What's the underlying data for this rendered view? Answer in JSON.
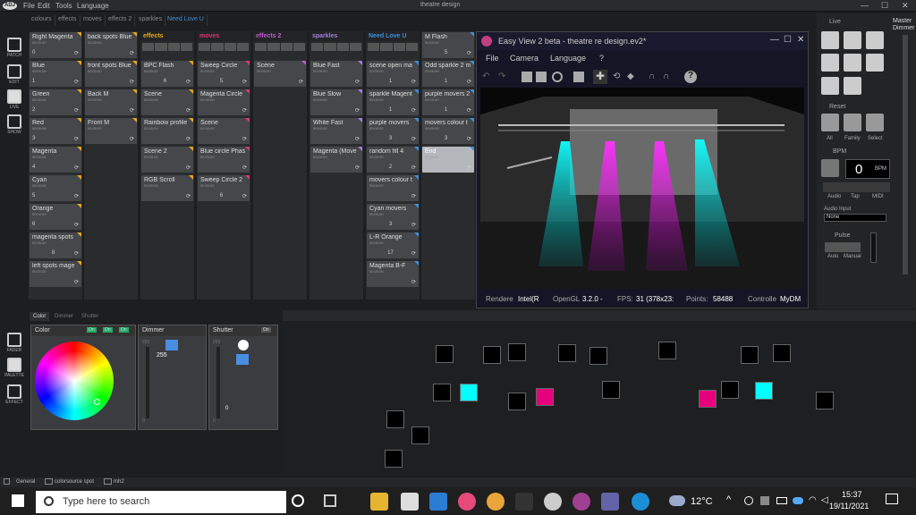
{
  "titlebar": {
    "logo": "ADJ",
    "menu": [
      "File",
      "Edit",
      "Tools",
      "Language"
    ],
    "title": "theatre design"
  },
  "scene_tabs": [
    "colours",
    "effects",
    "moves",
    "effects 2",
    "sparkles",
    "Need Love U"
  ],
  "left_toolbar": [
    {
      "label": "PATCH",
      "icon": "patch-icon"
    },
    {
      "label": "EDIT",
      "icon": "edit-icon"
    },
    {
      "label": "LIVE",
      "icon": "live-icon"
    },
    {
      "label": "SHOW",
      "icon": "show-icon"
    }
  ],
  "columns": [
    {
      "title": "colours",
      "color": "#e6a817",
      "cells": [
        {
          "name": "Right Magenta",
          "time": "00:00:00",
          "key": "0",
          "count": "",
          "corner": "#e6a817"
        },
        {
          "name": "Blue",
          "time": "00:00:05",
          "key": "1",
          "count": "",
          "corner": "#e6a817"
        },
        {
          "name": "Green",
          "time": "00:00:06",
          "key": "2",
          "count": "",
          "corner": "#e6a817"
        },
        {
          "name": "Red",
          "time": "00:00:06",
          "key": "3",
          "count": "",
          "corner": "#e6a817"
        },
        {
          "name": "Magenta",
          "time": "00:00:06",
          "key": "4",
          "count": "",
          "corner": "#e6a817"
        },
        {
          "name": "Cyan",
          "time": "00:00:06",
          "key": "5",
          "count": "",
          "corner": "#e6a817"
        },
        {
          "name": "Orange",
          "time": "00:00:00",
          "key": "6",
          "count": "",
          "corner": "#e6a817"
        },
        {
          "name": "magenta spots",
          "time": "00:00:00",
          "key": "",
          "count": "8",
          "corner": "#e6a817"
        },
        {
          "name": "left spots mage",
          "time": "00:00:00",
          "key": "",
          "count": "",
          "corner": "#e6a817"
        }
      ]
    },
    {
      "title": "",
      "color": "#e6a817",
      "cells": [
        {
          "name": "back spots Blue",
          "time": "00:00:00",
          "key": "",
          "count": "",
          "corner": "#e6a817"
        },
        {
          "name": "front spots Blue",
          "time": "00:00:00",
          "key": "",
          "count": "",
          "corner": "#e6a817"
        },
        {
          "name": "Back M",
          "time": "00:00:00",
          "key": "",
          "count": "",
          "corner": "#e6a817"
        },
        {
          "name": "Front M",
          "time": "00:00:00",
          "key": "",
          "count": "",
          "corner": "#e6a817"
        }
      ]
    },
    {
      "title": "effects",
      "color": "#e6a817",
      "cells": [
        {
          "name": "BPC Flash",
          "time": "00:00:00",
          "key": "",
          "count": "6",
          "corner": "#e6a817"
        },
        {
          "name": "Scene",
          "time": "00:00:00",
          "key": "",
          "count": "",
          "corner": "#e6a817"
        },
        {
          "name": "Rainbow profile",
          "time": "00:00:00",
          "key": "",
          "count": "",
          "corner": "#e6a817"
        },
        {
          "name": "Scene 2",
          "time": "00:00:00",
          "key": "",
          "count": "",
          "corner": "#e6a817"
        },
        {
          "name": "RGB Scroll",
          "time": "00:00:00",
          "key": "",
          "count": "",
          "corner": "#e6a817"
        }
      ]
    },
    {
      "title": "moves",
      "color": "#d93a6a",
      "cells": [
        {
          "name": "Sweep Circle",
          "time": "00:00:00",
          "key": "",
          "count": "5",
          "corner": "#d93a6a"
        },
        {
          "name": "Magenta Circle",
          "time": "00:00:00",
          "key": "",
          "count": "",
          "corner": "#d93a6a"
        },
        {
          "name": "Scene",
          "time": "00:00:00",
          "key": "",
          "count": "",
          "corner": "#d93a6a"
        },
        {
          "name": "Blue circle Phas",
          "time": "00:00:00",
          "key": "",
          "count": "",
          "corner": "#d93a6a"
        },
        {
          "name": "Sweep Circle 2",
          "time": "00:00:00",
          "key": "",
          "count": "6",
          "corner": "#d93a6a"
        }
      ]
    },
    {
      "title": "effects 2",
      "color": "#c05ad0",
      "cells": [
        {
          "name": "Scene",
          "time": "00:00:00",
          "key": "",
          "count": "",
          "corner": "#c05ad0"
        }
      ]
    },
    {
      "title": "sparkles",
      "color": "#a47ee0",
      "cells": [
        {
          "name": "Blue Fast",
          "time": "00:00:00",
          "key": "",
          "count": "",
          "corner": "#a47ee0"
        },
        {
          "name": "Blue Slow",
          "time": "00:00:00",
          "key": "",
          "count": "",
          "corner": "#a47ee0"
        },
        {
          "name": "White Fast",
          "time": "00:00:00",
          "key": "",
          "count": "",
          "corner": "#a47ee0"
        },
        {
          "name": "Magenta (Move",
          "time": "00:00:00",
          "key": "",
          "count": "",
          "corner": "#a47ee0"
        }
      ]
    },
    {
      "title": "Need Love U",
      "color": "#3b8fd8",
      "cells": [
        {
          "name": "scene open ma",
          "time": "00:00:00",
          "key": "",
          "count": "1",
          "corner": "#3b8fd8"
        },
        {
          "name": "sparkle Magent",
          "time": "00:00:00",
          "key": "",
          "count": "1",
          "corner": "#3b8fd8"
        },
        {
          "name": "purple movers",
          "time": "00:00:00",
          "key": "",
          "count": "3",
          "corner": "#3b8fd8"
        },
        {
          "name": "random fill 4",
          "time": "00:00:00",
          "key": "",
          "count": "2",
          "corner": "#3b8fd8"
        },
        {
          "name": "movers colour t",
          "time": "00:00:00",
          "key": "",
          "count": "",
          "corner": "#3b8fd8"
        },
        {
          "name": "Cyan movers",
          "time": "00:00:00",
          "key": "",
          "count": "3",
          "corner": "#3b8fd8"
        },
        {
          "name": "L-R Orange",
          "time": "00:00:00",
          "key": "",
          "count": "17",
          "corner": "#3b8fd8"
        },
        {
          "name": "Magenta B-F",
          "time": "00:00:00",
          "key": "",
          "count": "",
          "corner": "#3b8fd8"
        }
      ]
    },
    {
      "title": "",
      "color": "#3b8fd8",
      "cells": [
        {
          "name": "M Flash",
          "time": "00:00:00",
          "key": "",
          "count": "5",
          "corner": "#3b8fd8"
        },
        {
          "name": "Odd sparkle 2 m",
          "time": "00:00:00",
          "key": "",
          "count": "1",
          "corner": "#3b8fd8"
        },
        {
          "name": "purple movers 2",
          "time": "00:00:00",
          "key": "",
          "count": "1",
          "corner": "#3b8fd8"
        },
        {
          "name": "movers colour t",
          "time": "00:00:00",
          "key": "",
          "count": "3",
          "corner": "#3b8fd8"
        },
        {
          "name": "End",
          "time": "00:00:00",
          "key": "",
          "count": "",
          "corner": "#3b8fd8",
          "selected": true
        }
      ]
    }
  ],
  "easyview": {
    "title": "Easy View 2 beta - theatre re design.ev2*",
    "menu": [
      "File",
      "Camera",
      "Language",
      "?"
    ],
    "status": {
      "render_label": "Rendere",
      "render_value": "Intel(R",
      "opengl_label": "OpenGL",
      "opengl_value": "3.2.0 -",
      "fps_label": "FPS:",
      "fps_value": "31 (378x23:",
      "points_label": "Points:",
      "points_value": "58488",
      "control_label": "Controlle",
      "control_value": "MyDM"
    }
  },
  "right_panel": {
    "live_label": "Live",
    "master_label": "Master",
    "dimmer_label": "Dimmer",
    "reset_label": "Reset",
    "reset_buttons": [
      "All",
      "Family",
      "Select"
    ],
    "bpm_label": "BPM",
    "bpm_value": "0",
    "bpm_unit": "BPM",
    "bpm_buttons": [
      "Audio",
      "Tap",
      "MIDI"
    ],
    "audio_input_label": "Audio Input",
    "audio_input_value": "None",
    "pulse_label": "Pulse",
    "pulse_buttons": [
      "Auto",
      "Manual"
    ]
  },
  "bottom_tabs": [
    "Color",
    "Dimmer",
    "Shutter"
  ],
  "color_panel": {
    "title": "Color",
    "toggles": [
      "On",
      "On",
      "On"
    ]
  },
  "dimmer_panel": {
    "title": "Dimmer",
    "value": "255",
    "scale_top": "255",
    "scale_bottom": "0"
  },
  "shutter_panel": {
    "title": "Shutter",
    "toggle": "On",
    "value": "0",
    "scale_top": "255",
    "scale_bottom": "0"
  },
  "palette_tools": [
    {
      "label": "FADER",
      "icon": "fader-icon"
    },
    {
      "label": "PALETTE",
      "icon": "palette-icon"
    },
    {
      "label": "EFFECT",
      "icon": "effect-icon"
    }
  ],
  "footer_tabs": [
    "General",
    "colorsource spot",
    "mh2"
  ],
  "fixtures": [
    {
      "c": "#000"
    },
    {
      "c": "#000"
    },
    {
      "c": "#000"
    },
    {
      "c": "#000"
    },
    {
      "c": "#000"
    },
    {
      "c": "#000"
    },
    {
      "c": "#000"
    },
    {
      "c": "#000"
    },
    {
      "c": "#000"
    },
    {
      "c": "#0ff"
    },
    {
      "c": "#000"
    },
    {
      "c": "#e6007e"
    },
    {
      "c": "#000"
    },
    {
      "c": "#e6007e"
    },
    {
      "c": "#000"
    },
    {
      "c": "#0ff"
    },
    {
      "c": "#000"
    },
    {
      "c": "#000"
    },
    {
      "c": "#000"
    },
    {
      "c": "#000"
    }
  ],
  "taskbar": {
    "search_placeholder": "Type here to search",
    "weather": "12°C",
    "time": "15:37",
    "date": "19/11/2021"
  }
}
